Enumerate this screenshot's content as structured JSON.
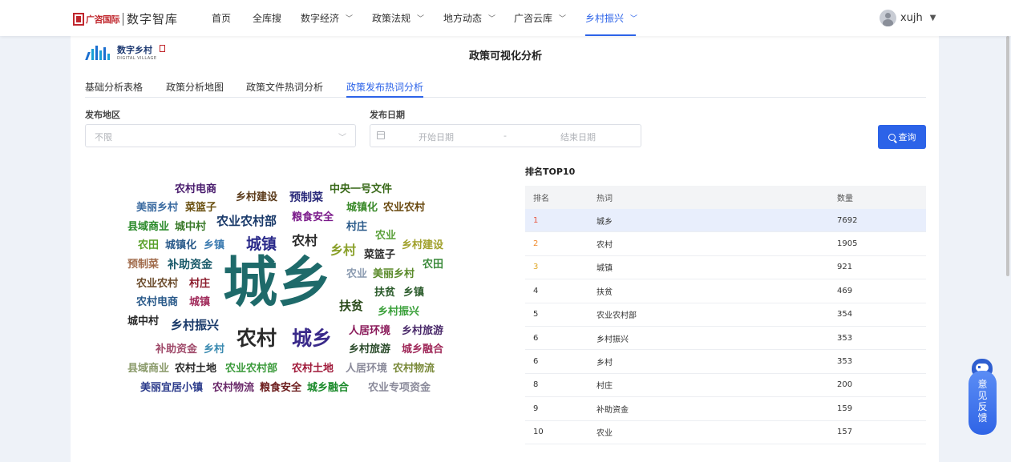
{
  "brand": {
    "small": "广咨国际",
    "main": "数字智库"
  },
  "nav": [
    {
      "label": "首页",
      "dropdown": false
    },
    {
      "label": "全库搜",
      "dropdown": false
    },
    {
      "label": "数字经济",
      "dropdown": true
    },
    {
      "label": "政策法规",
      "dropdown": true
    },
    {
      "label": "地方动态",
      "dropdown": true
    },
    {
      "label": "广咨云库",
      "dropdown": true
    },
    {
      "label": "乡村振兴",
      "dropdown": true,
      "active": true
    }
  ],
  "user": {
    "name": "xujh"
  },
  "logo2": {
    "cn": "数字乡村",
    "en": "DIGITAL VILLAGE"
  },
  "page_title": "政策可视化分析",
  "tabs": [
    "基础分析表格",
    "政策分析地图",
    "政策文件热词分析",
    "政策发布热词分析"
  ],
  "active_tab": 3,
  "filters": {
    "region_label": "发布地区",
    "region_value": "不限",
    "date_label": "发布日期",
    "start_placeholder": "开始日期",
    "range_sep": "-",
    "end_placeholder": "结束日期",
    "query_button": "查询"
  },
  "wordcloud": [
    {
      "text": "农村电商",
      "color": "#4a1d6e"
    },
    {
      "text": "乡村建设",
      "color": "#5a3a1a"
    },
    {
      "text": "预制菜",
      "color": "#2a2a7a"
    },
    {
      "text": "中央一号文件",
      "color": "#3a6a1a"
    },
    {
      "text": "美丽乡村",
      "color": "#3a6aa0"
    },
    {
      "text": "菜篮子",
      "color": "#6a5010"
    },
    {
      "text": "城镇化",
      "color": "#3a8a2a"
    },
    {
      "text": "农业农村",
      "color": "#6a4a10"
    },
    {
      "text": "县域商业",
      "color": "#2a8a2a"
    },
    {
      "text": "城中村",
      "color": "#3a7a2a"
    },
    {
      "text": "农业农村部",
      "color": "#1a3a6a"
    },
    {
      "text": "粮食安全",
      "color": "#7a1a8a"
    },
    {
      "text": "村庄",
      "color": "#2a5a8a"
    },
    {
      "text": "农田",
      "color": "#5aa02a"
    },
    {
      "text": "城镇化",
      "color": "#2a5a8a"
    },
    {
      "text": "乡镇",
      "color": "#3a7ab0"
    },
    {
      "text": "城镇",
      "color": "#2a2a8a"
    },
    {
      "text": "农村",
      "color": "#2a2a2a"
    },
    {
      "text": "农业",
      "color": "#5aa03a"
    },
    {
      "text": "乡村",
      "color": "#8aa02a"
    },
    {
      "text": "乡村建设",
      "color": "#a0a02a"
    },
    {
      "text": "预制菜",
      "color": "#a06a4a"
    },
    {
      "text": "补助资金",
      "color": "#1a5a6a"
    },
    {
      "text": "菜篮子",
      "color": "#2a2a2a"
    },
    {
      "text": "农田",
      "color": "#3a8a3a"
    },
    {
      "text": "农业农村",
      "color": "#6a4a2a"
    },
    {
      "text": "村庄",
      "color": "#8a1a2a"
    },
    {
      "text": "城乡",
      "color": "#1e6a6a"
    },
    {
      "text": "农业",
      "color": "#8a9ab0"
    },
    {
      "text": "美丽乡村",
      "color": "#5a8a2a"
    },
    {
      "text": "农村电商",
      "color": "#2a5a8a"
    },
    {
      "text": "城镇",
      "color": "#a02a5a"
    },
    {
      "text": "扶贫",
      "color": "#2a5a2a"
    },
    {
      "text": "乡镇",
      "color": "#2a5a2a"
    },
    {
      "text": "扶贫",
      "color": "#2a4a1a"
    },
    {
      "text": "乡村振兴",
      "color": "#3aa03a"
    },
    {
      "text": "城中村",
      "color": "#2a2a2a"
    },
    {
      "text": "乡村振兴",
      "color": "#1a3a6a"
    },
    {
      "text": "农村",
      "color": "#2a2a2a"
    },
    {
      "text": "城乡",
      "color": "#3a2a8a"
    },
    {
      "text": "人居环境",
      "color": "#8a1a5a"
    },
    {
      "text": "乡村旅游",
      "color": "#4a2a6a"
    },
    {
      "text": "补助资金",
      "color": "#a04a6a"
    },
    {
      "text": "乡村",
      "color": "#3a8ab0"
    },
    {
      "text": "乡村旅游",
      "color": "#2a4a2a"
    },
    {
      "text": "城乡融合",
      "color": "#a02a5a"
    },
    {
      "text": "县域商业",
      "color": "#8a9a6a"
    },
    {
      "text": "农村土地",
      "color": "#2a2a2a"
    },
    {
      "text": "农业农村部",
      "color": "#3a9a3a"
    },
    {
      "text": "农村土地",
      "color": "#a01a3a"
    },
    {
      "text": "人居环境",
      "color": "#8a8a9a"
    },
    {
      "text": "农村物流",
      "color": "#7a8a3a"
    },
    {
      "text": "美丽宜居小镇",
      "color": "#2a3a8a"
    },
    {
      "text": "农村物流",
      "color": "#6a2a6a"
    },
    {
      "text": "粮食安全",
      "color": "#6a1a1a"
    },
    {
      "text": "城乡融合",
      "color": "#1a8a2a"
    },
    {
      "text": "农业专项资金",
      "color": "#8a8a9a"
    }
  ],
  "top10": {
    "title": "排名TOP10",
    "headers": [
      "排名",
      "热词",
      "数量"
    ],
    "rows": [
      {
        "rank": "1",
        "word": "城乡",
        "count": "7692"
      },
      {
        "rank": "2",
        "word": "农村",
        "count": "1905"
      },
      {
        "rank": "3",
        "word": "城镇",
        "count": "921"
      },
      {
        "rank": "4",
        "word": "扶贫",
        "count": "469"
      },
      {
        "rank": "5",
        "word": "农业农村部",
        "count": "354"
      },
      {
        "rank": "6",
        "word": "乡村振兴",
        "count": "353"
      },
      {
        "rank": "6",
        "word": "乡村",
        "count": "353"
      },
      {
        "rank": "8",
        "word": "村庄",
        "count": "200"
      },
      {
        "rank": "9",
        "word": "补助资金",
        "count": "159"
      },
      {
        "rank": "10",
        "word": "农业",
        "count": "157"
      }
    ]
  },
  "feedback": "意见反馈"
}
